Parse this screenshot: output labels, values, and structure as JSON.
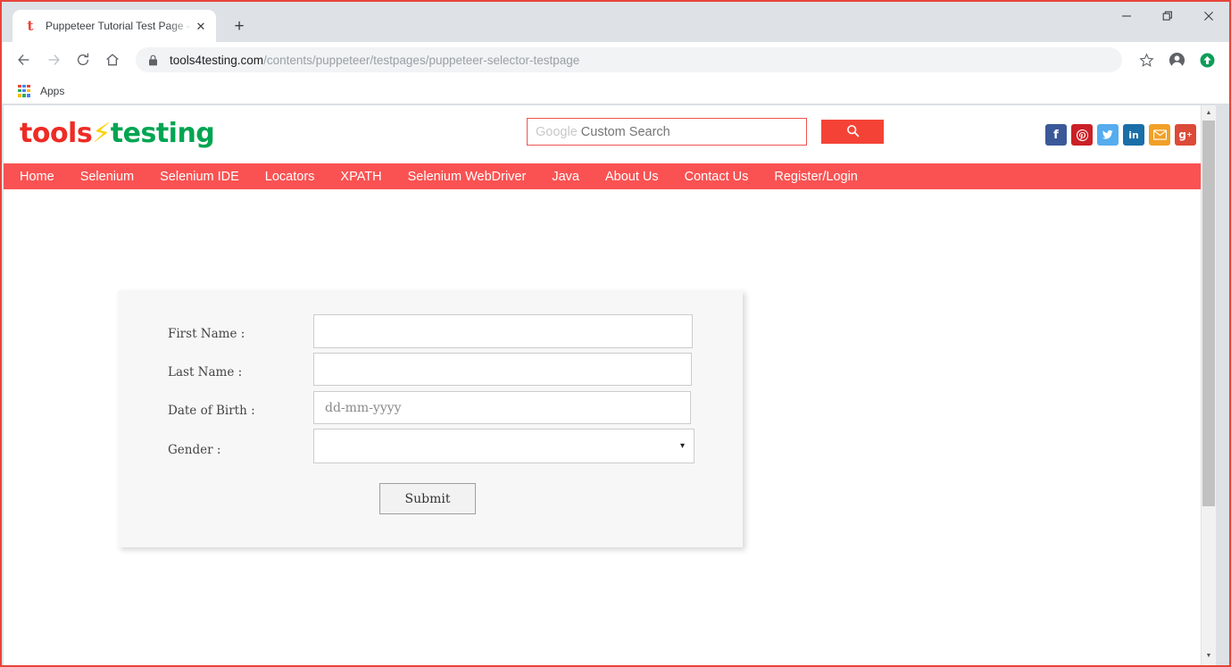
{
  "browser": {
    "tab": {
      "favicon": "t-favicon",
      "title": "Puppeteer Tutorial Test Page - to",
      "close_label": "✕"
    },
    "newtab_label": "+",
    "window_controls": {
      "minimize": "minimize-icon",
      "restore": "restore-icon",
      "close": "close-icon"
    },
    "toolbar": {
      "back": "back-arrow-icon",
      "forward": "forward-arrow-icon",
      "reload": "reload-icon",
      "home": "home-icon",
      "lock": "lock-icon",
      "url_host": "tools4testing.com",
      "url_path": "/contents/puppeteer/testpages/puppeteer-selector-testpage",
      "bookmark": "star-icon",
      "profile": "profile-avatar-icon",
      "update": "update-available-icon"
    },
    "bookmarks": {
      "apps_label": "Apps",
      "apps_icon": "apps-grid-icon",
      "apps_colors": [
        "#ea4335",
        "#4285f4",
        "#ea4335",
        "#34a853",
        "#4285f4",
        "#fbbc05",
        "#fbbc05",
        "#34a853",
        "#4285f4"
      ]
    }
  },
  "site": {
    "logo": {
      "part1": "tools",
      "bolt": "⚡",
      "part2": "testing"
    },
    "search": {
      "placeholder_brand": "Google",
      "placeholder_text": " Custom Search",
      "button_icon": "search-icon"
    },
    "socials": [
      {
        "name": "facebook",
        "glyph": "f",
        "color": "#3b5998"
      },
      {
        "name": "pinterest",
        "glyph": "ⓟ",
        "color": "#cb2027"
      },
      {
        "name": "twitter",
        "glyph": "ᵗ",
        "color": "#55acee"
      },
      {
        "name": "linkedin",
        "glyph": "in",
        "color": "#1a6fa8"
      },
      {
        "name": "email",
        "glyph": "✉",
        "color": "#f0a028"
      },
      {
        "name": "googleplus",
        "glyph": "g⁺",
        "color": "#dc4a38"
      }
    ],
    "nav": [
      "Home",
      "Selenium",
      "Selenium IDE",
      "Locators",
      "XPATH",
      "Selenium WebDriver",
      "Java",
      "About Us",
      "Contact Us",
      "Register/Login"
    ],
    "accent_color": "#fa5252"
  },
  "form": {
    "fields": [
      {
        "label": "First Name :",
        "value": "",
        "placeholder": "",
        "type": "text"
      },
      {
        "label": "Last Name :",
        "value": "",
        "placeholder": "",
        "type": "text"
      },
      {
        "label": "Date of Birth :",
        "value": "",
        "placeholder": "dd-mm-yyyy",
        "type": "text"
      },
      {
        "label": "Gender :",
        "value": "",
        "placeholder": "",
        "type": "select"
      }
    ],
    "gender_selected": "",
    "select_caret": "▾",
    "submit_label": "Submit"
  },
  "scrollbar": {
    "up_arrow": "▲",
    "down_arrow": "▼"
  }
}
